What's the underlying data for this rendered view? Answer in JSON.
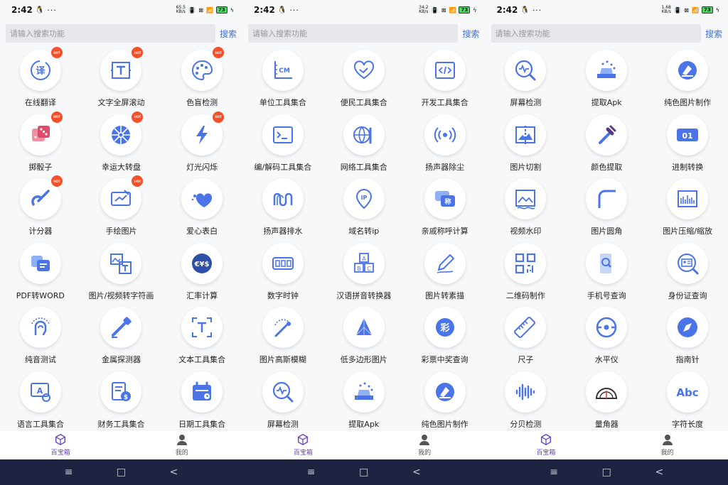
{
  "status": {
    "time": "2:42",
    "dots": "···",
    "speeds": [
      "65.5\nKB/s",
      "34.2\nKB/s",
      "1.68\nKB/s"
    ],
    "battery": "73"
  },
  "search": {
    "placeholder": "请输入搜索功能",
    "button": "搜索"
  },
  "tabs": [
    {
      "label": "百宝箱",
      "icon": "cube-icon"
    },
    {
      "label": "我的",
      "icon": "user-icon"
    }
  ],
  "navbar": {
    "menu": "≡",
    "home": "□",
    "back": "<"
  },
  "colors": {
    "accent": "#3d6fe0",
    "iconBlue": "#4a74e8",
    "hot": "#f5502a",
    "activeTab": "#6a45c2",
    "navbar": "#1e2341"
  },
  "screens": [
    {
      "items": [
        {
          "label": "在线翻译",
          "icon": "translate-icon",
          "hot": true
        },
        {
          "label": "文字全屏滚动",
          "icon": "text-scroll-icon",
          "hot": true
        },
        {
          "label": "色盲检测",
          "icon": "palette-icon",
          "hot": true
        },
        {
          "label": "掷骰子",
          "icon": "dice-icon",
          "hot": true
        },
        {
          "label": "幸运大转盘",
          "icon": "wheel-icon",
          "hot": true
        },
        {
          "label": "灯光闪烁",
          "icon": "flash-icon",
          "hot": true
        },
        {
          "label": "计分器",
          "icon": "counter-icon",
          "hot": true
        },
        {
          "label": "手绘图片",
          "icon": "draw-icon",
          "hot": true
        },
        {
          "label": "爱心表白",
          "icon": "heart-icon",
          "hot": false
        },
        {
          "label": "PDF转WORD",
          "icon": "pdf-word-icon",
          "hot": false
        },
        {
          "label": "图片/视频转字符画",
          "icon": "image-text-icon",
          "hot": false
        },
        {
          "label": "汇率计算",
          "icon": "currency-icon",
          "hot": false
        },
        {
          "label": "纯音测试",
          "icon": "ear-icon",
          "hot": false
        },
        {
          "label": "金属探测器",
          "icon": "metal-detector-icon",
          "hot": false
        },
        {
          "label": "文本工具集合",
          "icon": "text-tools-icon",
          "hot": false
        },
        {
          "label": "语言工具集合",
          "icon": "language-icon",
          "hot": false
        },
        {
          "label": "财务工具集合",
          "icon": "finance-icon",
          "hot": false
        },
        {
          "label": "日期工具集合",
          "icon": "calendar-icon",
          "hot": false
        }
      ]
    },
    {
      "items": [
        {
          "label": "单位工具集合",
          "icon": "ruler-cm-icon",
          "hot": false
        },
        {
          "label": "便民工具集合",
          "icon": "handshake-icon",
          "hot": false
        },
        {
          "label": "开发工具集合",
          "icon": "code-icon",
          "hot": false
        },
        {
          "label": "编/解码工具集合",
          "icon": "terminal-icon",
          "hot": false
        },
        {
          "label": "网络工具集合",
          "icon": "globe-tool-icon",
          "hot": false
        },
        {
          "label": "扬声器除尘",
          "icon": "speaker-icon",
          "hot": false
        },
        {
          "label": "扬声器排水",
          "icon": "wave-icon",
          "hot": false
        },
        {
          "label": "域名转ip",
          "icon": "ip-pin-icon",
          "hot": false
        },
        {
          "label": "亲戚称呼计算",
          "icon": "chat-icon",
          "hot": false
        },
        {
          "label": "数字时钟",
          "icon": "digital-clock-icon",
          "hot": false
        },
        {
          "label": "汉语拼音转换器",
          "icon": "abc-blocks-icon",
          "hot": false
        },
        {
          "label": "图片转素描",
          "icon": "pencil-icon",
          "hot": false
        },
        {
          "label": "图片高斯模糊",
          "icon": "blur-wand-icon",
          "hot": false
        },
        {
          "label": "低多边形图片",
          "icon": "polygon-icon",
          "hot": false
        },
        {
          "label": "彩票中奖查询",
          "icon": "lottery-icon",
          "hot": false
        },
        {
          "label": "屏幕检测",
          "icon": "screen-check-icon",
          "hot": false
        },
        {
          "label": "提取Apk",
          "icon": "apk-icon",
          "hot": false
        },
        {
          "label": "纯色图片制作",
          "icon": "fill-icon",
          "hot": false
        }
      ]
    },
    {
      "items": [
        {
          "label": "屏幕检测",
          "icon": "screen-check-icon",
          "hot": false
        },
        {
          "label": "提取Apk",
          "icon": "apk-icon",
          "hot": false
        },
        {
          "label": "纯色图片制作",
          "icon": "fill-icon",
          "hot": false
        },
        {
          "label": "图片切割",
          "icon": "image-cut-icon",
          "hot": false
        },
        {
          "label": "颜色提取",
          "icon": "eyedropper-icon",
          "hot": false
        },
        {
          "label": "进制转换",
          "icon": "binary-icon",
          "hot": false
        },
        {
          "label": "视频水印",
          "icon": "watermark-icon",
          "hot": false
        },
        {
          "label": "图片圆角",
          "icon": "round-corner-icon",
          "hot": false
        },
        {
          "label": "图片压缩/缩放",
          "icon": "compress-icon",
          "hot": false
        },
        {
          "label": "二维码制作",
          "icon": "qr-icon",
          "hot": false
        },
        {
          "label": "手机号查询",
          "icon": "phone-search-icon",
          "hot": false
        },
        {
          "label": "身份证查询",
          "icon": "id-card-icon",
          "hot": false
        },
        {
          "label": "尺子",
          "icon": "ruler-icon",
          "hot": false
        },
        {
          "label": "水平仪",
          "icon": "level-icon",
          "hot": false
        },
        {
          "label": "指南针",
          "icon": "compass-icon",
          "hot": false
        },
        {
          "label": "分贝检测",
          "icon": "decibel-icon",
          "hot": false
        },
        {
          "label": "量角器",
          "icon": "protractor-icon",
          "hot": false
        },
        {
          "label": "字符长度",
          "icon": "abc-text-icon",
          "hot": false
        }
      ]
    }
  ]
}
